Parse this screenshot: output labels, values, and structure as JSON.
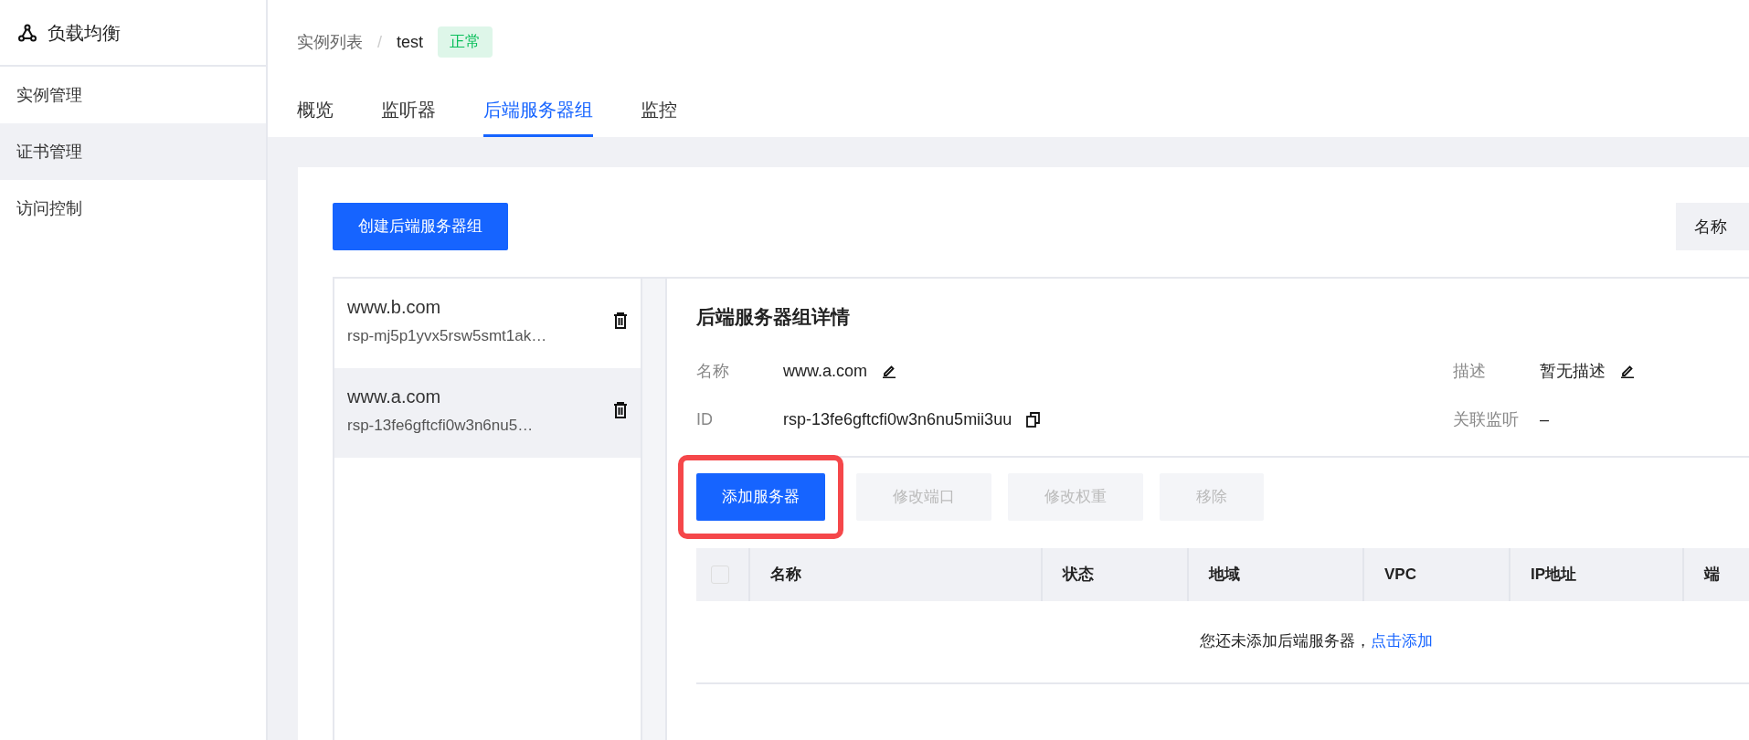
{
  "sidebar": {
    "title": "负载均衡",
    "items": [
      {
        "label": "实例管理",
        "selected": false
      },
      {
        "label": "证书管理",
        "selected": true
      },
      {
        "label": "访问控制",
        "selected": false
      }
    ]
  },
  "breadcrumb": {
    "parent": "实例列表",
    "separator": "/",
    "current": "test",
    "status": {
      "label": "正常",
      "color": "#0abf5b"
    }
  },
  "tabs": [
    {
      "label": "概览",
      "selected": false
    },
    {
      "label": "监听器",
      "selected": false
    },
    {
      "label": "后端服务器组",
      "selected": true
    },
    {
      "label": "监控",
      "selected": false
    }
  ],
  "create_button": "创建后端服务器组",
  "filter_select": "名称",
  "groups": [
    {
      "name": "www.b.com",
      "id": "rsp-mj5p1yvx5rsw5smt1ak…",
      "selected": false
    },
    {
      "name": "www.a.com",
      "id": "rsp-13fe6gftcfi0w3n6nu5…",
      "selected": true
    }
  ],
  "detail": {
    "title": "后端服务器组详情",
    "fields": [
      {
        "label": "名称",
        "value": "www.a.com",
        "kind": "editable"
      },
      {
        "label": "描述",
        "value": "暂无描述",
        "kind": "editable"
      },
      {
        "label": "ID",
        "value": "rsp-13fe6gftcfi0w3n6nu5mii3uu",
        "kind": "copyable"
      },
      {
        "label": "关联监听",
        "value": "–",
        "kind": "plain"
      }
    ],
    "actions": [
      {
        "label": "添加服务器",
        "kind": "primary",
        "disabled": false,
        "highlighted": true
      },
      {
        "label": "修改端口",
        "kind": "default",
        "disabled": true,
        "highlighted": false
      },
      {
        "label": "修改权重",
        "kind": "default",
        "disabled": true,
        "highlighted": false
      },
      {
        "label": "移除",
        "kind": "default",
        "disabled": true,
        "highlighted": false
      }
    ],
    "table": {
      "select_all": {
        "checked": false,
        "disabled": true
      },
      "columns": [
        "名称",
        "状态",
        "地域",
        "VPC",
        "IP地址",
        "端"
      ],
      "empty_text": "您还未添加后端服务器，",
      "empty_link": "点击添加"
    }
  }
}
